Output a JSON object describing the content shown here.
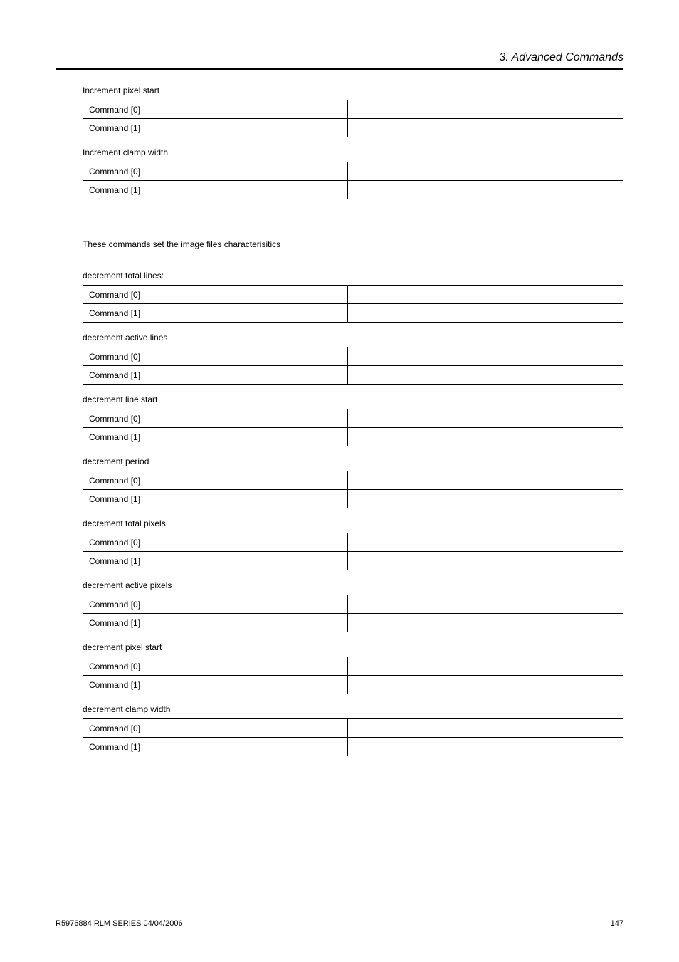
{
  "header": {
    "title": "3.  Advanced Commands"
  },
  "row_labels": {
    "cmd0": "Command [0]",
    "cmd1": "Command [1]"
  },
  "sections_top": [
    {
      "caption": "Increment pixel start"
    },
    {
      "caption": "Increment clamp width"
    }
  ],
  "description": "These commands set the image files characterisitics",
  "sections_bottom": [
    {
      "caption": "decrement total lines:"
    },
    {
      "caption": "decrement active lines"
    },
    {
      "caption": "decrement line start"
    },
    {
      "caption": "decrement period"
    },
    {
      "caption": "decrement total pixels"
    },
    {
      "caption": "decrement active pixels"
    },
    {
      "caption": "decrement pixel start"
    },
    {
      "caption": "decrement clamp width"
    }
  ],
  "footer": {
    "doc_id": "R5976884  RLM SERIES  04/04/2006",
    "page_number": "147"
  }
}
